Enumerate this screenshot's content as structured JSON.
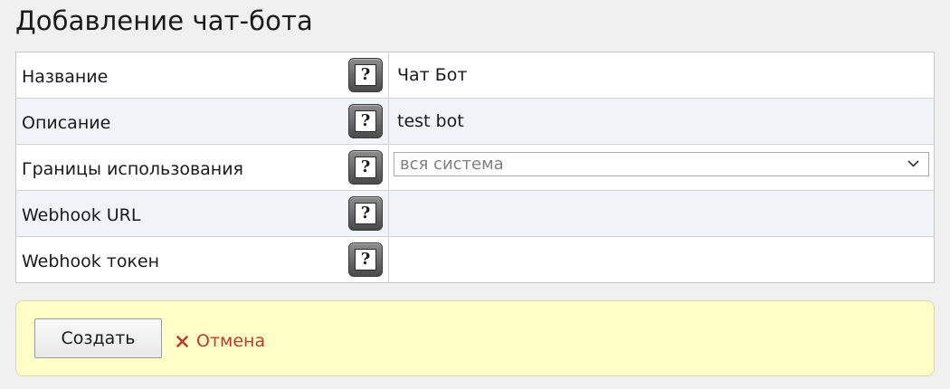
{
  "page": {
    "title": "Добавление чат-бота"
  },
  "form": {
    "rows": [
      {
        "label": "Название",
        "value": "Чат Бот"
      },
      {
        "label": "Описание",
        "value": "test bot"
      },
      {
        "label": "Границы использования",
        "select_value": "вся система"
      },
      {
        "label": "Webhook URL",
        "value": ""
      },
      {
        "label": "Webhook токен",
        "value": ""
      }
    ],
    "help_glyph": "?"
  },
  "actions": {
    "create_label": "Создать",
    "cancel_label": "Отмена"
  },
  "icons": {
    "help": "help-icon",
    "close": "close-icon",
    "chevron": "chevron-down-icon"
  },
  "colors": {
    "panel_background": "#ffffc8",
    "cancel_link": "#c0392b",
    "alt_row": "#f0f3f8"
  }
}
